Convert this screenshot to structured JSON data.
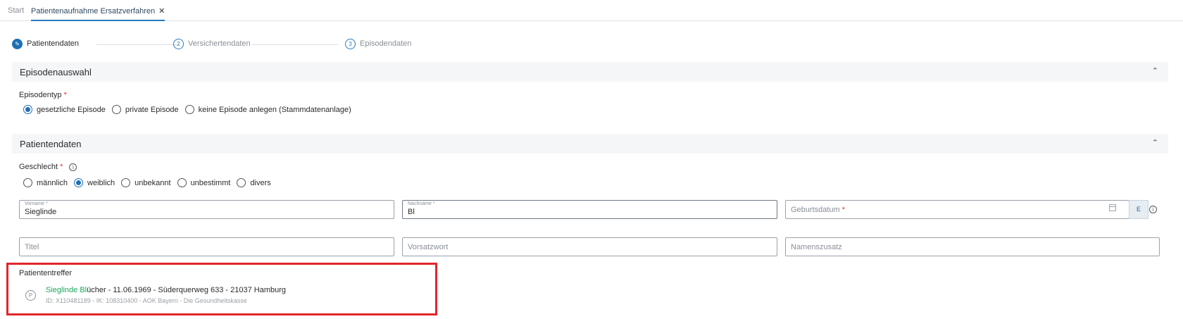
{
  "tabs": {
    "start_label": "Start",
    "active_label": "Patientenaufnahme Ersatzverfahren",
    "close_glyph": "✕"
  },
  "stepper": {
    "steps": [
      {
        "number": "✎",
        "label": "Patientendaten"
      },
      {
        "number": "2",
        "label": "Versichertendaten"
      },
      {
        "number": "3",
        "label": "Episodendaten"
      }
    ]
  },
  "episode_section": {
    "title": "Episodenauswahl",
    "collapse_glyph": "⌃",
    "type_label": "Episodentyp",
    "required_mark": "*",
    "options": [
      {
        "label": "gesetzliche Episode",
        "checked": true
      },
      {
        "label": "private Episode",
        "checked": false
      },
      {
        "label": "keine Episode anlegen (Stammdatenanlage)",
        "checked": false
      }
    ]
  },
  "patient_section": {
    "title": "Patientendaten",
    "collapse_glyph": "⌃",
    "gender_label": "Geschlecht",
    "required_mark": "*",
    "info_glyph": "i",
    "gender_options": [
      {
        "label": "männlich",
        "checked": false
      },
      {
        "label": "weiblich",
        "checked": true
      },
      {
        "label": "unbekannt",
        "checked": false
      },
      {
        "label": "unbestimmt",
        "checked": false
      },
      {
        "label": "divers",
        "checked": false
      }
    ],
    "fields": {
      "vorname_label": "Vorname *",
      "vorname_value": "Sieglinde",
      "nachname_label": "Nachname *",
      "nachname_value": "Bl",
      "geburtsdatum_placeholder": "Geburtsdatum",
      "geburtsdatum_required": "*",
      "e_button_label": "E",
      "titel_placeholder": "Titel",
      "vorsatzwort_placeholder": "Vorsatzwort",
      "namenszusatz_placeholder": "Namenszusatz"
    }
  },
  "results": {
    "heading": "Patiententreffer",
    "items": [
      {
        "badge": "P",
        "highlight": "Sieglinde Bl",
        "rest": "ücher - 11.06.1969 - Süderquerweg 633 - 21037 Hamburg",
        "sub": "ID: X110481189 - IK: 108310400 - AOK Bayern - Die Gesundheitskasse"
      }
    ]
  },
  "colors": {
    "accent": "#1f6fb4",
    "highlight": "#1ea55c",
    "required": "#d9383a",
    "callout_border": "#e0262b"
  }
}
